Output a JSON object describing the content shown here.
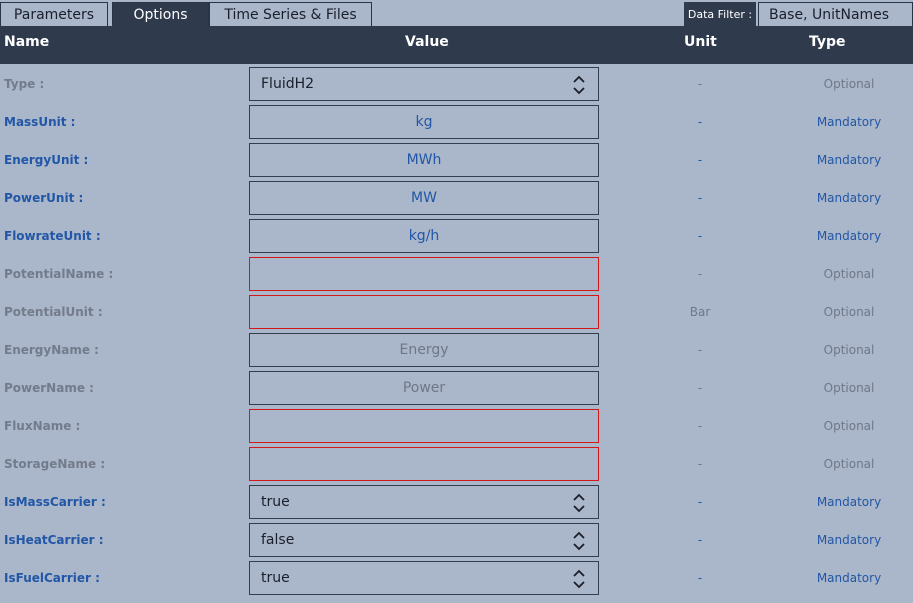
{
  "tabs": {
    "parameters": "Parameters",
    "options": "Options",
    "timeseries": "Time Series & Files"
  },
  "filter": {
    "label": "Data Filter :",
    "value": "Base, UnitNames"
  },
  "columns": {
    "name": "Name",
    "value": "Value",
    "unit": "Unit",
    "type": "Type"
  },
  "rows": [
    {
      "name": "Type :",
      "value": "FluidH2",
      "unit": "-",
      "type": "Optional"
    },
    {
      "name": "MassUnit :",
      "value": "kg",
      "unit": "-",
      "type": "Mandatory"
    },
    {
      "name": "EnergyUnit :",
      "value": "MWh",
      "unit": "-",
      "type": "Mandatory"
    },
    {
      "name": "PowerUnit :",
      "value": "MW",
      "unit": "-",
      "type": "Mandatory"
    },
    {
      "name": "FlowrateUnit :",
      "value": "kg/h",
      "unit": "-",
      "type": "Mandatory"
    },
    {
      "name": "PotentialName :",
      "value": "",
      "unit": "-",
      "type": "Optional"
    },
    {
      "name": "PotentialUnit :",
      "value": "",
      "unit": "Bar",
      "type": "Optional"
    },
    {
      "name": "EnergyName :",
      "value": "Energy",
      "unit": "-",
      "type": "Optional"
    },
    {
      "name": "PowerName :",
      "value": "Power",
      "unit": "-",
      "type": "Optional"
    },
    {
      "name": "FluxName :",
      "value": "",
      "unit": "-",
      "type": "Optional"
    },
    {
      "name": "StorageName :",
      "value": "",
      "unit": "-",
      "type": "Optional"
    },
    {
      "name": "IsMassCarrier :",
      "value": "true",
      "unit": "-",
      "type": "Mandatory"
    },
    {
      "name": "IsHeatCarrier :",
      "value": "false",
      "unit": "-",
      "type": "Mandatory"
    },
    {
      "name": "IsFuelCarrier :",
      "value": "true",
      "unit": "-",
      "type": "Mandatory"
    }
  ],
  "colors": {
    "background": "#aab6c9",
    "header": "#2f3a4d",
    "mandatory": "#2157a6",
    "optional": "#727c8c",
    "error_border": "#d01818"
  }
}
